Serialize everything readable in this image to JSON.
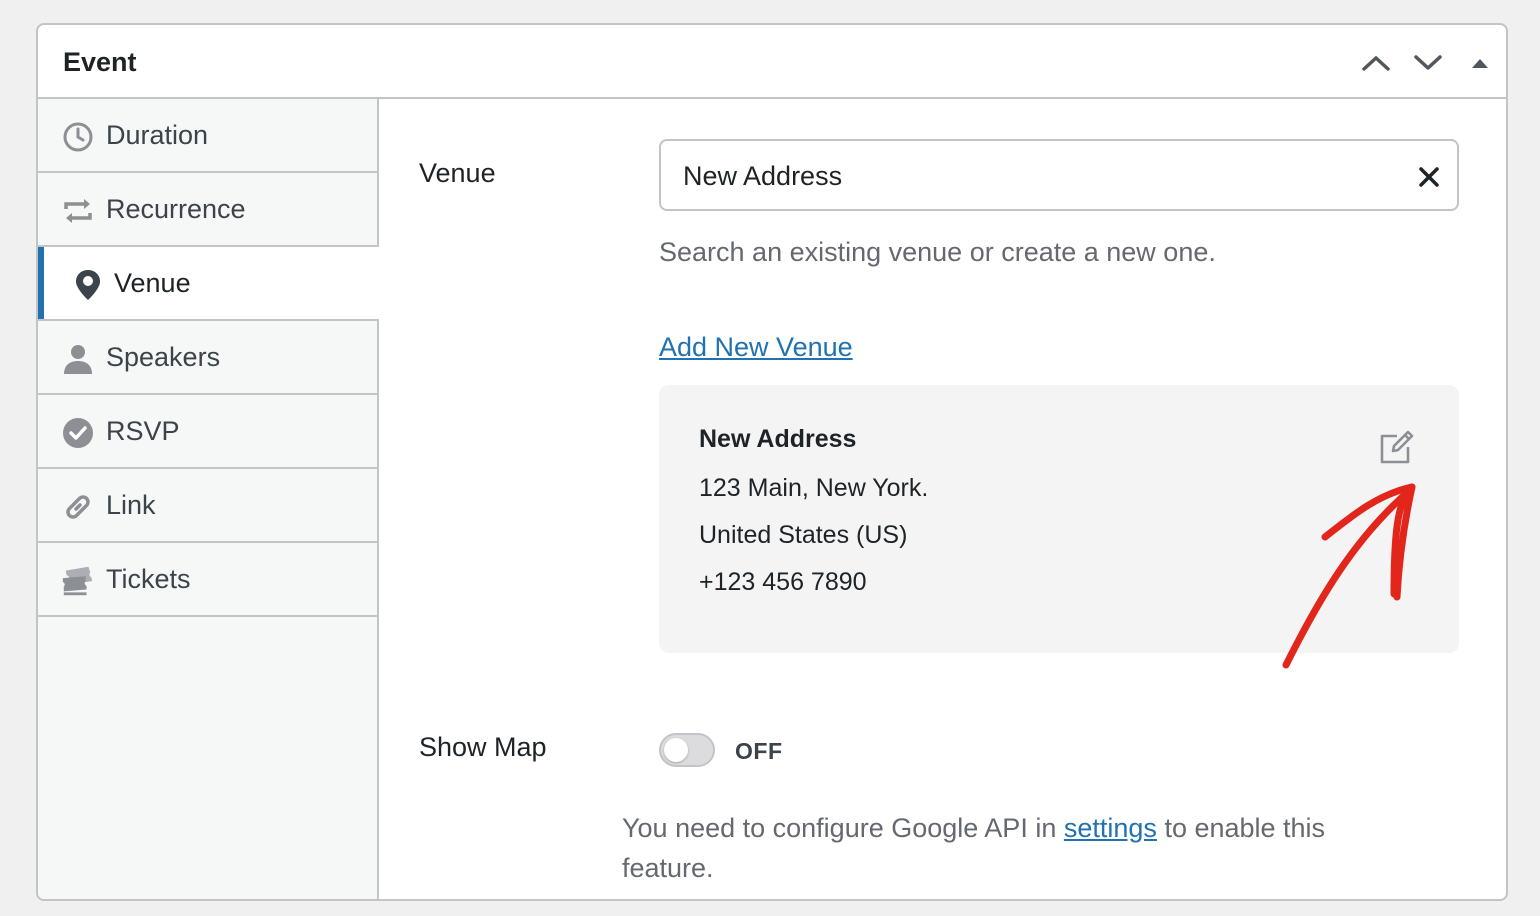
{
  "panel": {
    "title": "Event",
    "controls": {
      "up": "chevron-up-icon",
      "down": "chevron-down-icon",
      "toggle": "triangle-up-icon"
    }
  },
  "sidebar": {
    "items": [
      {
        "label": "Duration",
        "icon": "clock-icon"
      },
      {
        "label": "Recurrence",
        "icon": "repeat-icon"
      },
      {
        "label": "Venue",
        "icon": "location-pin-icon",
        "active": true
      },
      {
        "label": "Speakers",
        "icon": "person-icon"
      },
      {
        "label": "RSVP",
        "icon": "check-circle-icon"
      },
      {
        "label": "Link",
        "icon": "link-icon"
      },
      {
        "label": "Tickets",
        "icon": "tickets-icon"
      }
    ]
  },
  "venue": {
    "label": "Venue",
    "input_value": "New Address",
    "help": "Search an existing venue or create a new one.",
    "add_new": "Add New Venue",
    "card": {
      "name": "New Address",
      "address": "123 Main, New York.",
      "country": "United States (US)",
      "phone": "+123 456 7890"
    }
  },
  "map": {
    "label": "Show Map",
    "state": "OFF",
    "note_before": "You need to configure Google API in",
    "note_link": "settings",
    "note_after": "to enable this",
    "note_after_2": "feature."
  },
  "colors": {
    "accent": "#2271b1",
    "annotation": "#e3261c"
  }
}
